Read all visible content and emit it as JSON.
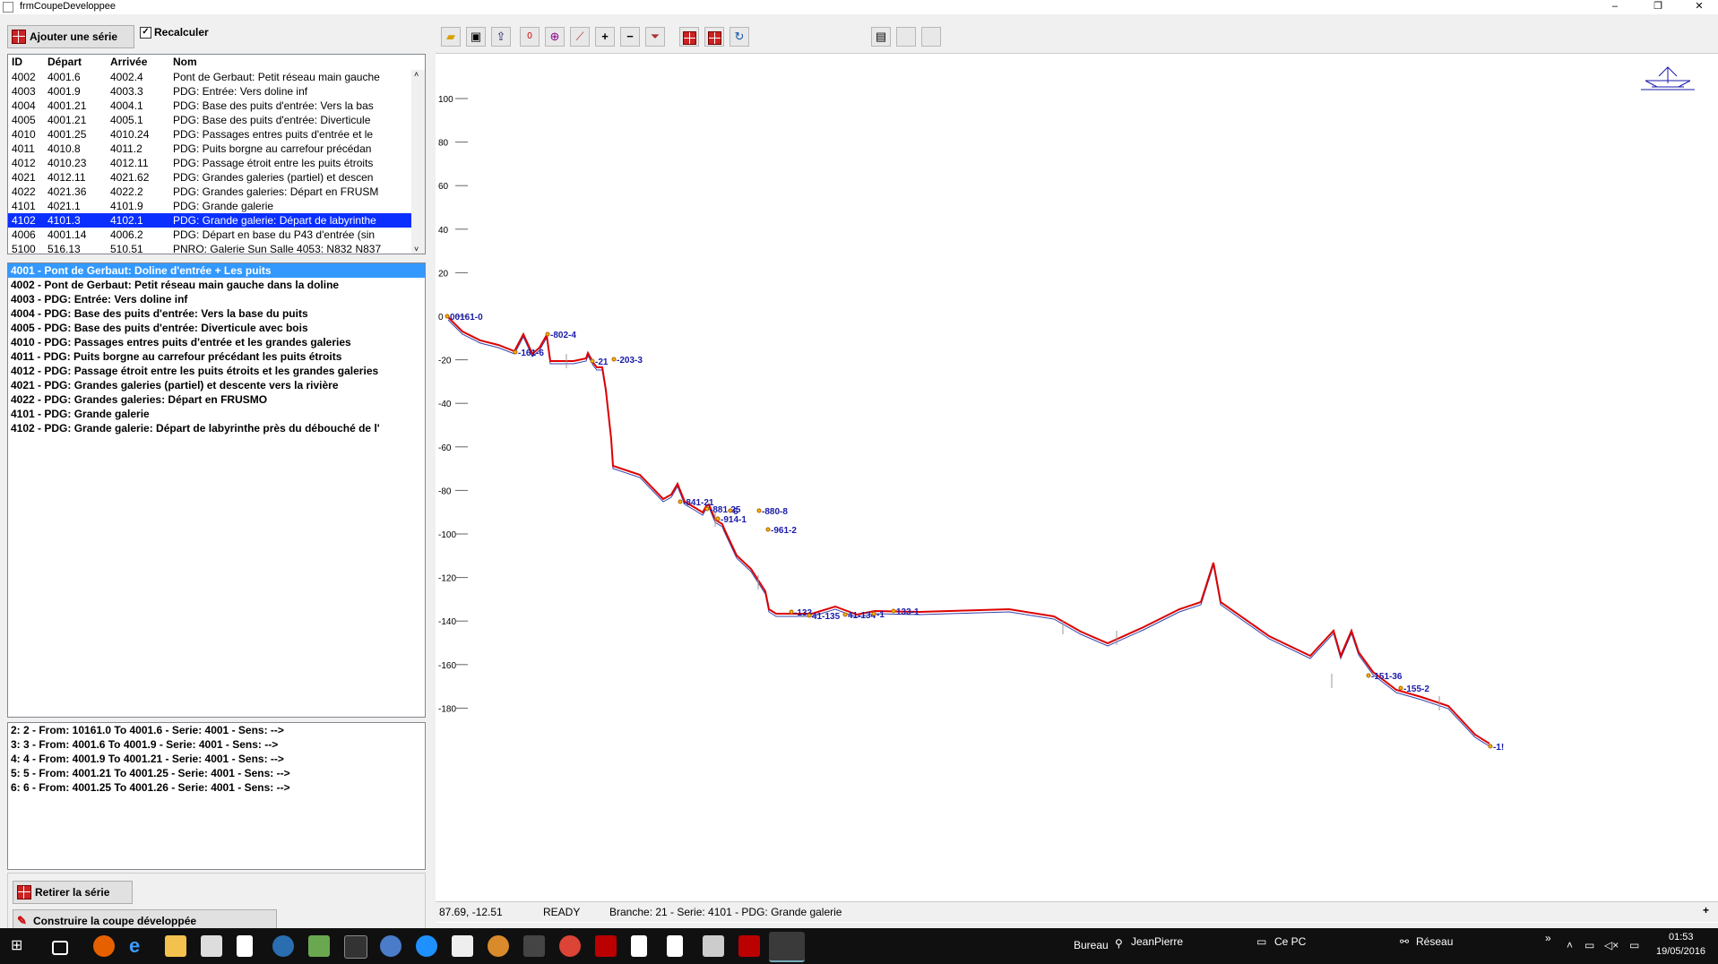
{
  "window": {
    "title": "frmCoupeDeveloppee",
    "min": "–",
    "max": "❐",
    "close": "✕"
  },
  "left": {
    "add_series_label": "Ajouter une série",
    "recalc_label": "Recalculer",
    "recalc_checked": true,
    "grid": {
      "headers": [
        "ID",
        "Départ",
        "Arrivée",
        "Nom"
      ],
      "rows": [
        [
          "4002",
          "4001.6",
          "4002.4",
          "Pont de Gerbaut: Petit réseau main gauche"
        ],
        [
          "4003",
          "4001.9",
          "4003.3",
          "PDG: Entrée: Vers doline inf"
        ],
        [
          "4004",
          "4001.21",
          "4004.1",
          "PDG: Base des puits d'entrée: Vers la bas"
        ],
        [
          "4005",
          "4001.21",
          "4005.1",
          "PDG: Base des puits d'entrée: Diverticule"
        ],
        [
          "4010",
          "4001.25",
          "4010.24",
          "PDG: Passages entres puits d'entrée et le"
        ],
        [
          "4011",
          "4010.8",
          "4011.2",
          "PDG: Puits borgne au carrefour précédan"
        ],
        [
          "4012",
          "4010.23",
          "4012.11",
          "PDG: Passage étroit entre les puits étroits"
        ],
        [
          "4021",
          "4012.11",
          "4021.62",
          "PDG: Grandes galeries (partiel) et descen"
        ],
        [
          "4022",
          "4021.36",
          "4022.2",
          "PDG: Grandes galeries: Départ en FRUSM"
        ],
        [
          "4101",
          "4021.1",
          "4101.9",
          "PDG: Grande galerie"
        ],
        [
          "4102",
          "4101.3",
          "4102.1",
          "PDG: Grande galerie: Départ de labyrinthe"
        ],
        [
          "4006",
          "4001.14",
          "4006.2",
          "PDG: Départ en base du P43 d'entrée (sin"
        ],
        [
          "5100",
          "516.13",
          "510.51",
          "PNRO: Galerie Sun Salle 4053: N832 N837"
        ]
      ],
      "selected_index": 10
    },
    "series_list": [
      "4001 - Pont de Gerbaut: Doline d'entrée + Les puits",
      "4002 - Pont de Gerbaut: Petit réseau main gauche dans la doline",
      "4003 - PDG: Entrée: Vers doline inf",
      "4004 - PDG: Base des puits d'entrée: Vers la base du puits",
      "4005 - PDG: Base des puits d'entrée: Diverticule avec bois",
      "4010 - PDG: Passages entres puits d'entrée et les grandes  galeries",
      "4011 - PDG: Puits borgne au carrefour précédant les puits étroits",
      "4012 - PDG: Passage étroit entre les puits étroits et les grandes galeries",
      "4021 - PDG: Grandes galeries (partiel) et descente vers la rivière",
      "4022 - PDG: Grandes galeries: Départ en FRUSMO",
      "4101 - PDG: Grande galerie",
      "4102 - PDG: Grande galerie: Départ de labyrinthe près du débouché de l'"
    ],
    "shots_list": [
      "2: 2 - From: 10161.0 To 4001.6 - Serie: 4001 - Sens: -->",
      "3: 3 - From: 4001.6 To 4001.9 - Serie: 4001 - Sens: -->",
      "4: 4 - From: 4001.9 To 4001.21 - Serie: 4001 - Sens: -->",
      "5: 5 - From: 4001.21 To 4001.25 - Serie: 4001 - Sens: -->",
      "6: 6 - From: 4001.25 To 4001.26 - Serie: 4001 - Sens: -->"
    ],
    "remove_series_label": "Retirer la série",
    "build_label": "Construire la coupe développée"
  },
  "toolbar": {
    "icons": [
      "open-folder-icon",
      "save-icon",
      "export-icon",
      "zero-icon",
      "zoom-icon",
      "measure-icon",
      "plus-icon",
      "minus-icon",
      "filter-icon",
      "grid-red-icon",
      "grid-red2-icon",
      "refresh-icon",
      "settings-icon",
      "blank-icon",
      "blank-icon"
    ]
  },
  "plot": {
    "y_ticks": [
      100,
      80,
      60,
      40,
      20,
      0,
      -20,
      -40,
      -60,
      -80,
      -100,
      -120,
      -140,
      -160,
      -180
    ],
    "labels": [
      {
        "text": "00161-0"
      },
      {
        "text": "-802-4"
      },
      {
        "text": "-161-6"
      },
      {
        "text": "-21"
      },
      {
        "text": "-203-3"
      },
      {
        "text": "-841-21"
      },
      {
        "text": "-881-25"
      },
      {
        "text": "-914-1"
      },
      {
        "text": "6"
      },
      {
        "text": "-880-8"
      },
      {
        "text": "-961-2"
      },
      {
        "text": "-133"
      },
      {
        "text": "41-135"
      },
      {
        "text": "41-134"
      },
      {
        "text": "-1"
      },
      {
        "text": "133-1"
      },
      {
        "text": "-151-36"
      },
      {
        "text": "-155-2"
      },
      {
        "text": "-1!"
      }
    ],
    "line_color": "#dd0000",
    "label_color": "#1a1aaa"
  },
  "status": {
    "coords": "87.69, -12.51",
    "state": "READY",
    "info": "Branche: 21 - Serie: 4101 - PDG: Grande galerie",
    "plus": "+"
  },
  "taskbar": {
    "bureau": "Bureau",
    "user": "JeanPierre",
    "pc": "Ce PC",
    "network": "Réseau",
    "time": "01:53",
    "date": "19/05/2016",
    "chevron": "»"
  }
}
